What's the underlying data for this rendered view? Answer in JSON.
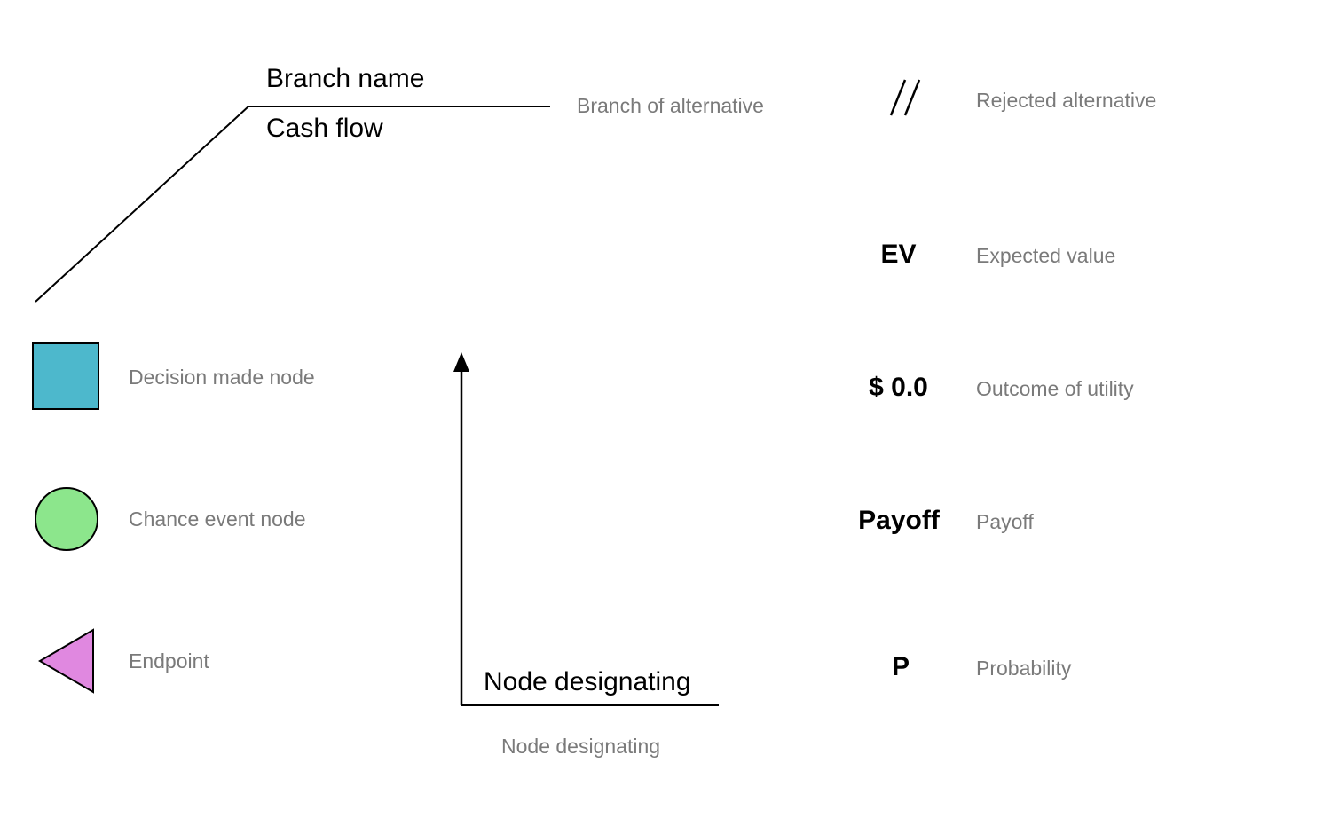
{
  "branch": {
    "top_label": "Branch name",
    "bottom_label": "Cash flow",
    "description": "Branch of alternative"
  },
  "shapes": {
    "decision": {
      "label": "Decision made node"
    },
    "chance": {
      "label": "Chance event node"
    },
    "endpoint": {
      "label": "Endpoint"
    }
  },
  "node_designating": {
    "above_line": "Node designating",
    "caption": "Node designating"
  },
  "right_column": {
    "rejected": {
      "symbol": "\\\\",
      "label": "Rejected alternative"
    },
    "ev": {
      "symbol": "EV",
      "label": "Expected value"
    },
    "utility": {
      "symbol": "$ 0.0",
      "label": "Outcome of utility"
    },
    "payoff": {
      "symbol": "Payoff",
      "label": "Payoff"
    },
    "probability": {
      "symbol": "P",
      "label": "Probability"
    }
  }
}
